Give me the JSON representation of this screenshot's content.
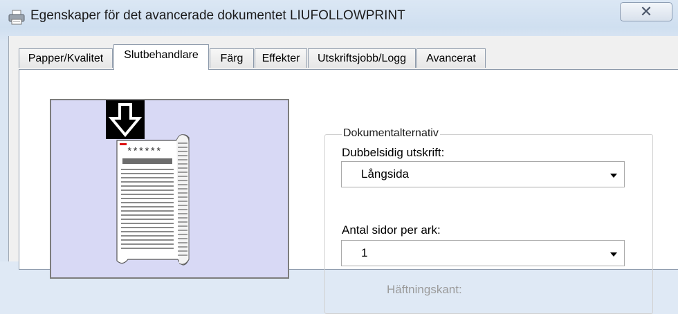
{
  "window": {
    "title": "Egenskaper för det avancerade dokumentet LIUFOLLOWPRINT",
    "close_symbol": "✕"
  },
  "tabs": [
    {
      "label": "Papper/Kvalitet",
      "active": false
    },
    {
      "label": "Slutbehandlare",
      "active": true
    },
    {
      "label": "Färg",
      "active": false
    },
    {
      "label": "Effekter",
      "active": false
    },
    {
      "label": "Utskriftsjobb/Logg",
      "active": false
    },
    {
      "label": "Avancerat",
      "active": false
    }
  ],
  "preview": {
    "arrow_icon": "down-arrow-icon",
    "document_icon": "document-icon",
    "stars_text": "******"
  },
  "document_options": {
    "group_label": "Dokumentalternativ",
    "duplex": {
      "label": "Dubbelsidig utskrift:",
      "value": "Långsida"
    },
    "pages_per_sheet": {
      "label": "Antal sidor per ark:",
      "value": "1"
    },
    "binding_edge_label": "Häftningskant:"
  }
}
